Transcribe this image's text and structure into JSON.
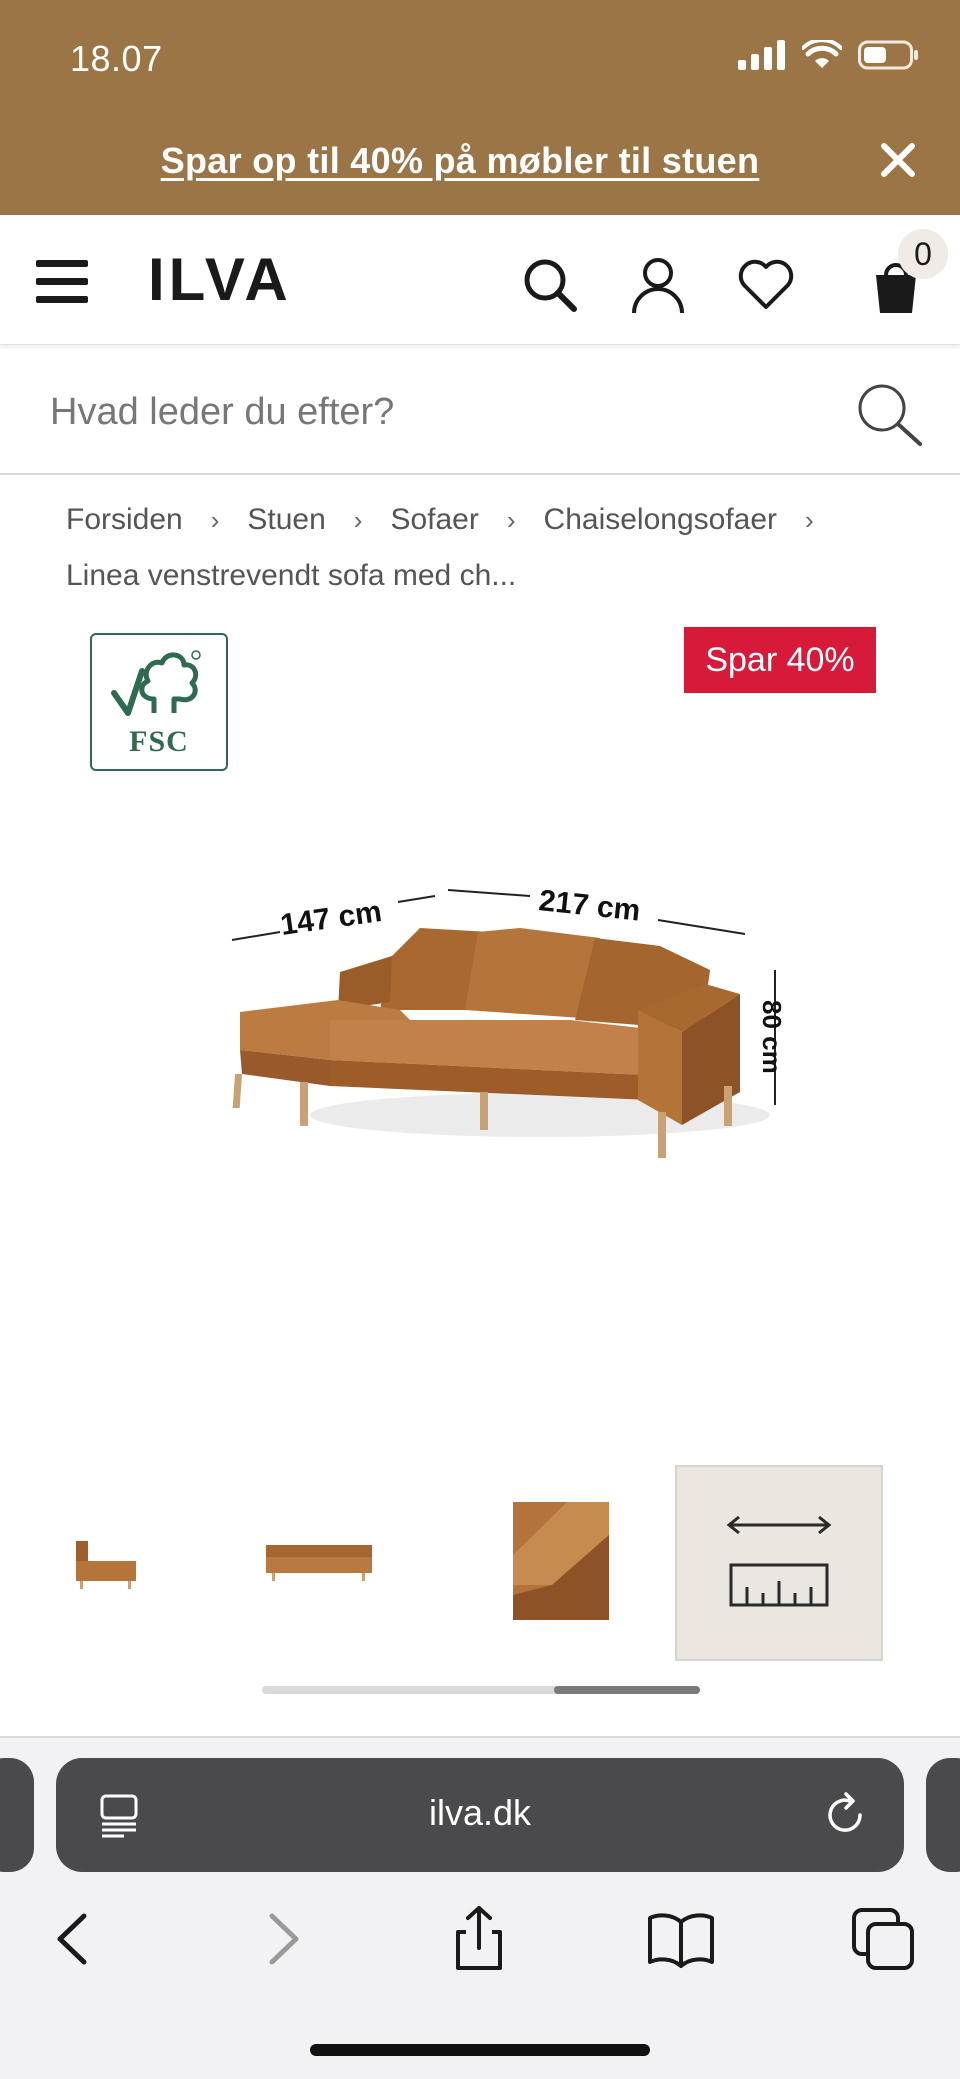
{
  "status_bar": {
    "time": "18.07"
  },
  "promo": {
    "text": "Spar op til 40% på møbler til stuen"
  },
  "header": {
    "logo": "ILVA",
    "cart_count": "0"
  },
  "search": {
    "placeholder": "Hvad leder du efter?"
  },
  "breadcrumb": {
    "items": [
      "Forsiden",
      "Stuen",
      "Sofaer",
      "Chaiselongsofaer",
      "Linea venstrevendt sofa med ch..."
    ],
    "separator": "›"
  },
  "product": {
    "certification": "FSC",
    "discount_badge": "Spar 40%",
    "dimensions": {
      "width": "217 cm",
      "chaise": "147 cm",
      "height": "80 cm"
    }
  },
  "gallery": {
    "thumbnails": [
      "sofa-side-view",
      "sofa-front-view",
      "sofa-leather-detail",
      "dimensions-icon"
    ],
    "active_index": 3
  },
  "browser": {
    "url": "ilva.dk"
  },
  "colors": {
    "banner": "#9c7547",
    "badge": "#d7193a",
    "fsc_green": "#2f6b4f",
    "sofa_leather": "#b0703a"
  }
}
